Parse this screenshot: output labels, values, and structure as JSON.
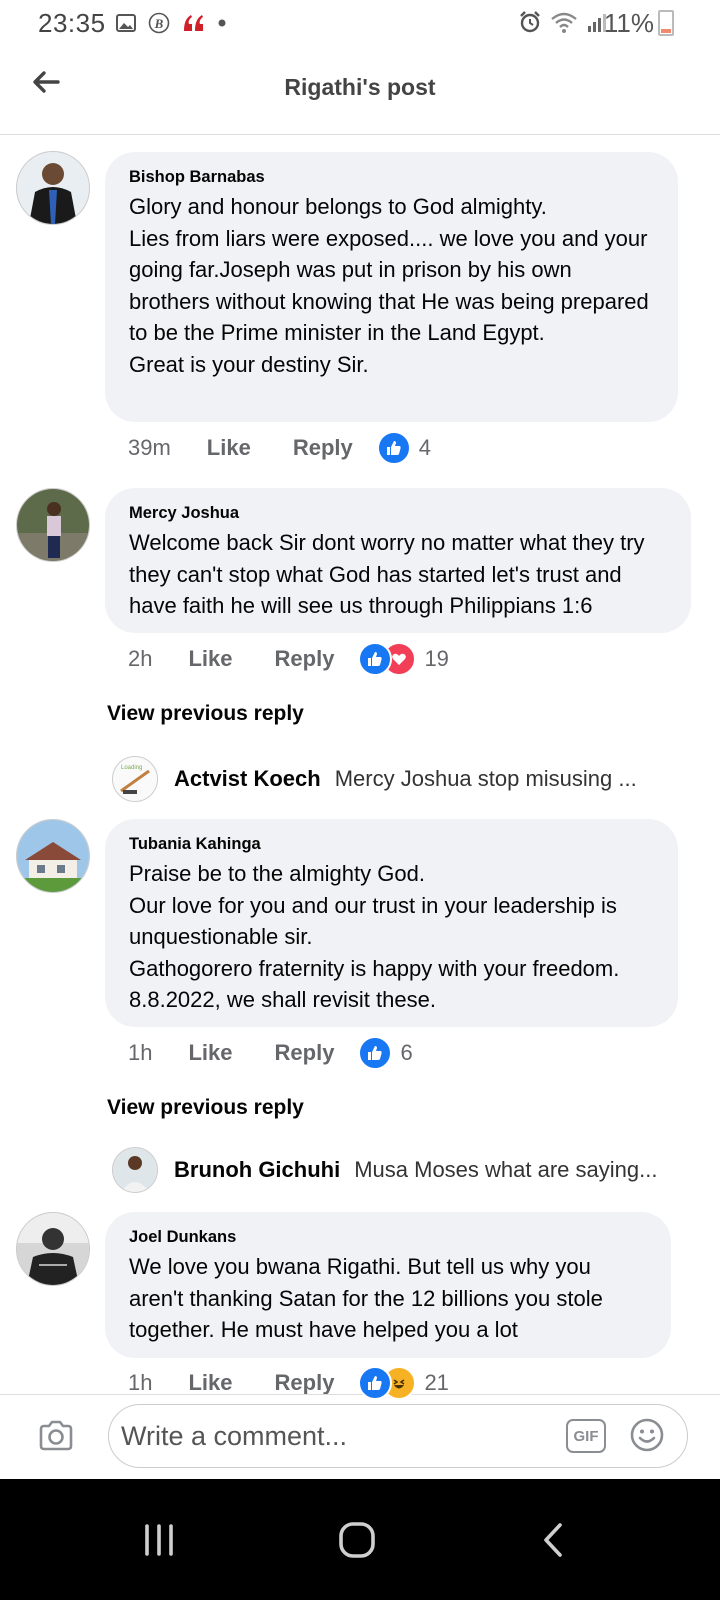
{
  "status_bar": {
    "time": "23:35",
    "battery": "11%"
  },
  "header": {
    "title": "Rigathi's post"
  },
  "comments": [
    {
      "author": "Bishop Barnabas",
      "text": "Glory and honour belongs to God almighty.\nLies from liars were exposed.... we love you and your going far.Joseph was put in prison by his own brothers without knowing that He was being prepared to be the Prime minister in the Land Egypt.\nGreat is your destiny Sir.",
      "time": "39m",
      "like_label": "Like",
      "reply_label": "Reply",
      "reaction_count": "4"
    },
    {
      "author": "Mercy Joshua",
      "text": "Welcome back Sir dont worry no matter what they try they can't stop what God has started let's trust and have faith he will see us through Philippians 1:6",
      "time": "2h",
      "like_label": "Like",
      "reply_label": "Reply",
      "reaction_count": "19",
      "view_previous": "View previous reply",
      "reply": {
        "author": "Actvist Koech",
        "text": "Mercy Joshua stop misusing ..."
      }
    },
    {
      "author": "Tubania Kahinga",
      "text": "Praise be to the almighty God.\nOur love for you and our trust in your leadership is unquestionable sir.\nGathogorero fraternity is happy with your freedom. 8.8.2022, we shall revisit these.",
      "time": "1h",
      "like_label": "Like",
      "reply_label": "Reply",
      "reaction_count": "6",
      "view_previous": "View previous reply",
      "reply": {
        "author": "Brunoh Gichuhi",
        "text": "Musa Moses what are saying..."
      }
    },
    {
      "author": "Joel Dunkans",
      "text": "We love you bwana Rigathi. But tell us why you aren't  thanking Satan for the 12 billions you stole together. He must have helped you a lot",
      "time": "1h",
      "like_label": "Like",
      "reply_label": "Reply",
      "reaction_count": "21"
    }
  ],
  "composer": {
    "placeholder": "Write a comment...",
    "gif_label": "GIF"
  },
  "colors": {
    "like_blue": "#1877f2",
    "love_red": "#f33e58",
    "haha_yellow": "#f7b125",
    "bubble_gray": "#f0f2f5",
    "secondary_text": "#65676b"
  },
  "icons": [
    "gallery-icon",
    "b-icon",
    "quote-icon",
    "alarm-icon",
    "wifi-icon",
    "signal-icon",
    "battery-icon",
    "back-arrow-icon",
    "camera-icon",
    "gif-icon",
    "emoji-icon",
    "recent-apps-icon",
    "home-icon",
    "nav-back-icon"
  ]
}
